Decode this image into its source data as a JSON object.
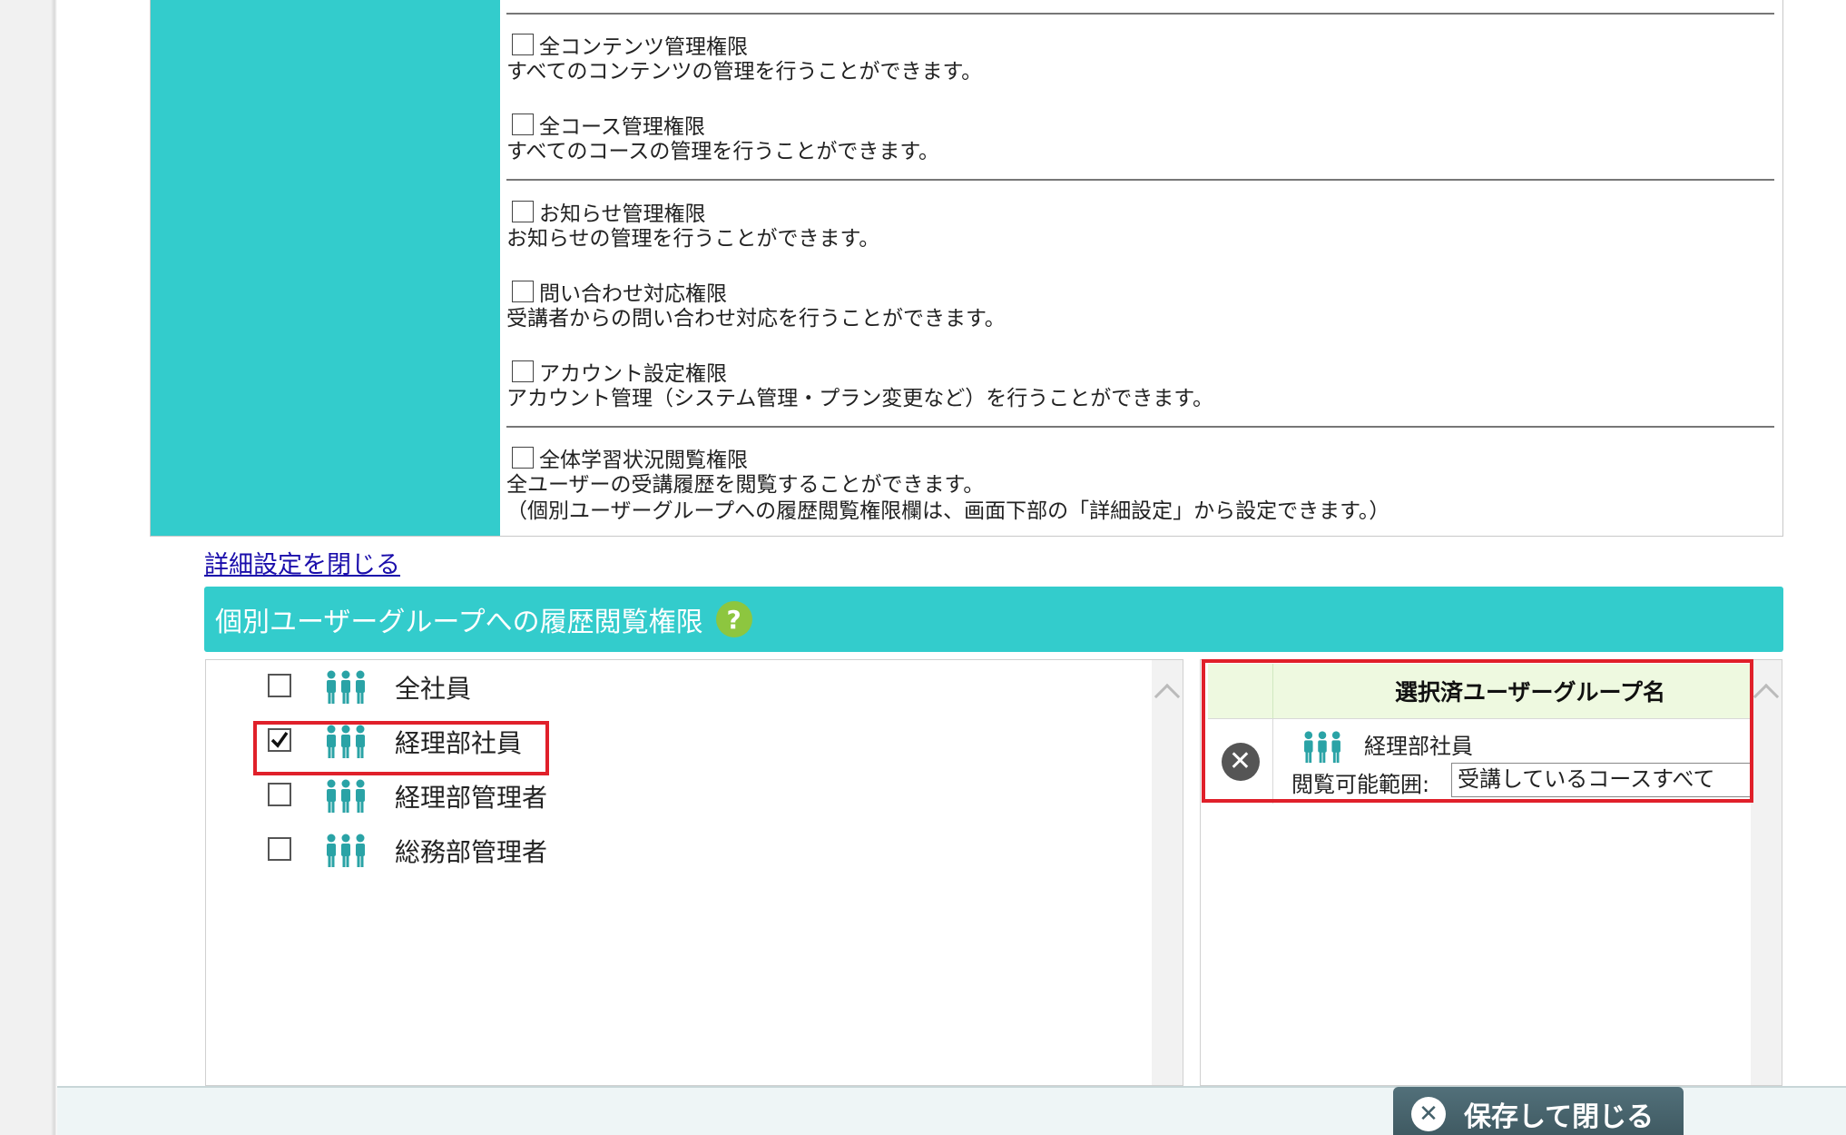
{
  "permissions": {
    "items": [
      {
        "title": "全コンテンツ管理権限",
        "desc": "すべてのコンテンツの管理を行うことができます。"
      },
      {
        "title": "全コース管理権限",
        "desc": "すべてのコースの管理を行うことができます。"
      },
      {
        "title": "お知らせ管理権限",
        "desc": "お知らせの管理を行うことができます。"
      },
      {
        "title": "問い合わせ対応権限",
        "desc": "受講者からの問い合わせ対応を行うことができます。"
      },
      {
        "title": "アカウント設定権限",
        "desc": "アカウント管理（システム管理・プラン変更など）を行うことができます。"
      },
      {
        "title": "全体学習状況閲覧権限",
        "desc": "全ユーザーの受講履歴を閲覧することができます。",
        "desc2": "（個別ユーザーグループへの履歴閲覧権限欄は、画面下部の「詳細設定」から設定できます。）"
      }
    ]
  },
  "close_detail_link": "詳細設定を閉じる",
  "history_section": {
    "title": "個別ユーザーグループへの履歴閲覧権限",
    "help_icon": "?"
  },
  "groups": [
    {
      "label": "全社員",
      "checked": false
    },
    {
      "label": "経理部社員",
      "checked": true
    },
    {
      "label": "経理部管理者",
      "checked": false
    },
    {
      "label": "総務部管理者",
      "checked": false
    }
  ],
  "selected_panel": {
    "header": "選択済ユーザーグループ名",
    "rows": [
      {
        "name": "経理部社員",
        "range_label": "閲覧可能範囲:",
        "range_value": "受講しているコースすべて"
      }
    ]
  },
  "footer": {
    "save_close_label": "保存して閉じる"
  },
  "colors": {
    "accent_teal": "#33cccc",
    "help_green": "#8dc63f",
    "highlight_red": "#e0202a",
    "save_button": "#4a656e"
  },
  "icons": {
    "group": "group-icon",
    "remove": "remove-circle-icon",
    "help": "help-icon",
    "close": "close-circle-icon",
    "scroll_up": "chevron-up-icon"
  }
}
